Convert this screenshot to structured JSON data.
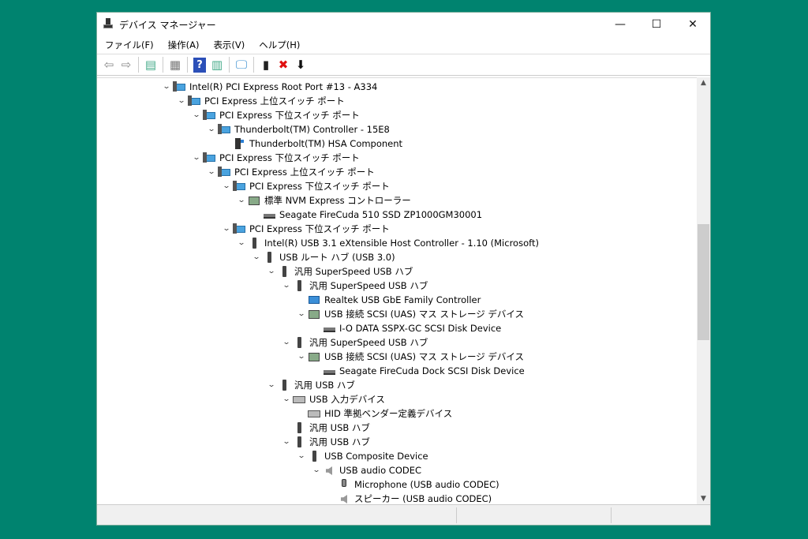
{
  "window": {
    "title": "デバイス マネージャー",
    "minimize": "—",
    "maximize": "☐",
    "close": "✕"
  },
  "menu": [
    "ファイル(F)",
    "操作(A)",
    "表示(V)",
    "ヘルプ(H)"
  ],
  "toolbar": [
    {
      "name": "back-icon",
      "glyph": "⇦",
      "color": "#888"
    },
    {
      "name": "forward-icon",
      "glyph": "⇨",
      "color": "#888"
    },
    {
      "sep": true
    },
    {
      "name": "show-hide-console-tree-icon",
      "glyph": "▤",
      "color": "#4a8"
    },
    {
      "sep": true
    },
    {
      "name": "properties-icon",
      "glyph": "▦",
      "color": "#777"
    },
    {
      "sep": true
    },
    {
      "name": "help-icon",
      "glyph": "?",
      "color": "#fff",
      "bg": "#2b4fb8"
    },
    {
      "name": "show-action-pane-icon",
      "glyph": "▥",
      "color": "#4a8"
    },
    {
      "sep": true
    },
    {
      "name": "scan-hardware-icon",
      "glyph": "🖵",
      "color": "#3a8fd0"
    },
    {
      "sep": true
    },
    {
      "name": "update-driver-icon",
      "glyph": "▮",
      "color": "#222"
    },
    {
      "name": "uninstall-device-icon",
      "glyph": "✖",
      "color": "#e01010"
    },
    {
      "name": "disable-device-icon",
      "glyph": "⬇",
      "color": "#111"
    }
  ],
  "tree": [
    {
      "level": 0,
      "exp": true,
      "icon": "pci",
      "text": "Intel(R) PCI Express Root Port #13 - A334"
    },
    {
      "level": 1,
      "exp": true,
      "icon": "pci",
      "text": "PCI Express 上位スイッチ ポート"
    },
    {
      "level": 2,
      "exp": true,
      "icon": "pci",
      "text": "PCI Express 下位スイッチ ポート"
    },
    {
      "level": 3,
      "exp": true,
      "icon": "pci",
      "text": "Thunderbolt(TM) Controller - 15E8"
    },
    {
      "level": 4,
      "exp": false,
      "icon": "tb",
      "text": "Thunderbolt(TM) HSA Component"
    },
    {
      "level": 2,
      "exp": true,
      "icon": "pci",
      "text": "PCI Express 下位スイッチ ポート"
    },
    {
      "level": 3,
      "exp": true,
      "icon": "pci",
      "text": "PCI Express 上位スイッチ ポート"
    },
    {
      "level": 4,
      "exp": true,
      "icon": "pci",
      "text": "PCI Express 下位スイッチ ポート"
    },
    {
      "level": 5,
      "exp": true,
      "icon": "stor",
      "text": "標準 NVM Express コントローラー"
    },
    {
      "level": 6,
      "exp": false,
      "icon": "disk",
      "text": "Seagate FireCuda 510 SSD ZP1000GM30001"
    },
    {
      "level": 4,
      "exp": true,
      "icon": "pci",
      "text": "PCI Express 下位スイッチ ポート"
    },
    {
      "level": 5,
      "exp": true,
      "icon": "usb",
      "text": "Intel(R) USB 3.1 eXtensible Host Controller - 1.10 (Microsoft)"
    },
    {
      "level": 6,
      "exp": true,
      "icon": "usb",
      "text": "USB ルート ハブ (USB 3.0)"
    },
    {
      "level": 7,
      "exp": true,
      "icon": "usb",
      "text": "汎用 SuperSpeed USB ハブ"
    },
    {
      "level": 8,
      "exp": true,
      "icon": "usb",
      "text": "汎用 SuperSpeed USB ハブ"
    },
    {
      "level": 9,
      "exp": false,
      "icon": "net",
      "text": "Realtek USB GbE Family Controller"
    },
    {
      "level": 9,
      "exp": true,
      "icon": "stor",
      "text": "USB 接続 SCSI (UAS) マス ストレージ デバイス"
    },
    {
      "level": 10,
      "exp": false,
      "icon": "disk",
      "text": "I-O DATA SSPX-GC SCSI Disk Device"
    },
    {
      "level": 8,
      "exp": true,
      "icon": "usb",
      "text": "汎用 SuperSpeed USB ハブ"
    },
    {
      "level": 9,
      "exp": true,
      "icon": "stor",
      "text": "USB 接続 SCSI (UAS) マス ストレージ デバイス"
    },
    {
      "level": 10,
      "exp": false,
      "icon": "disk",
      "text": "Seagate FireCuda Dock SCSI Disk Device"
    },
    {
      "level": 7,
      "exp": true,
      "icon": "usb",
      "text": "汎用 USB ハブ"
    },
    {
      "level": 8,
      "exp": true,
      "icon": "kb",
      "text": "USB 入力デバイス"
    },
    {
      "level": 9,
      "exp": false,
      "icon": "kb",
      "text": "HID 準拠ベンダー定義デバイス"
    },
    {
      "level": 8,
      "exp": false,
      "icon": "usb",
      "text": "汎用 USB ハブ"
    },
    {
      "level": 8,
      "exp": true,
      "icon": "usb",
      "text": "汎用 USB ハブ"
    },
    {
      "level": 9,
      "exp": true,
      "icon": "usb",
      "text": "USB Composite Device"
    },
    {
      "level": 10,
      "exp": true,
      "icon": "aud",
      "text": "USB audio CODEC"
    },
    {
      "level": 11,
      "exp": false,
      "icon": "mic",
      "text": "Microphone (USB audio CODEC)"
    },
    {
      "level": 11,
      "exp": false,
      "icon": "aud",
      "text": "スピーカー (USB audio CODEC)"
    }
  ],
  "scroll": {
    "up": "▲",
    "down": "▼",
    "position_fraction": 0.38
  }
}
